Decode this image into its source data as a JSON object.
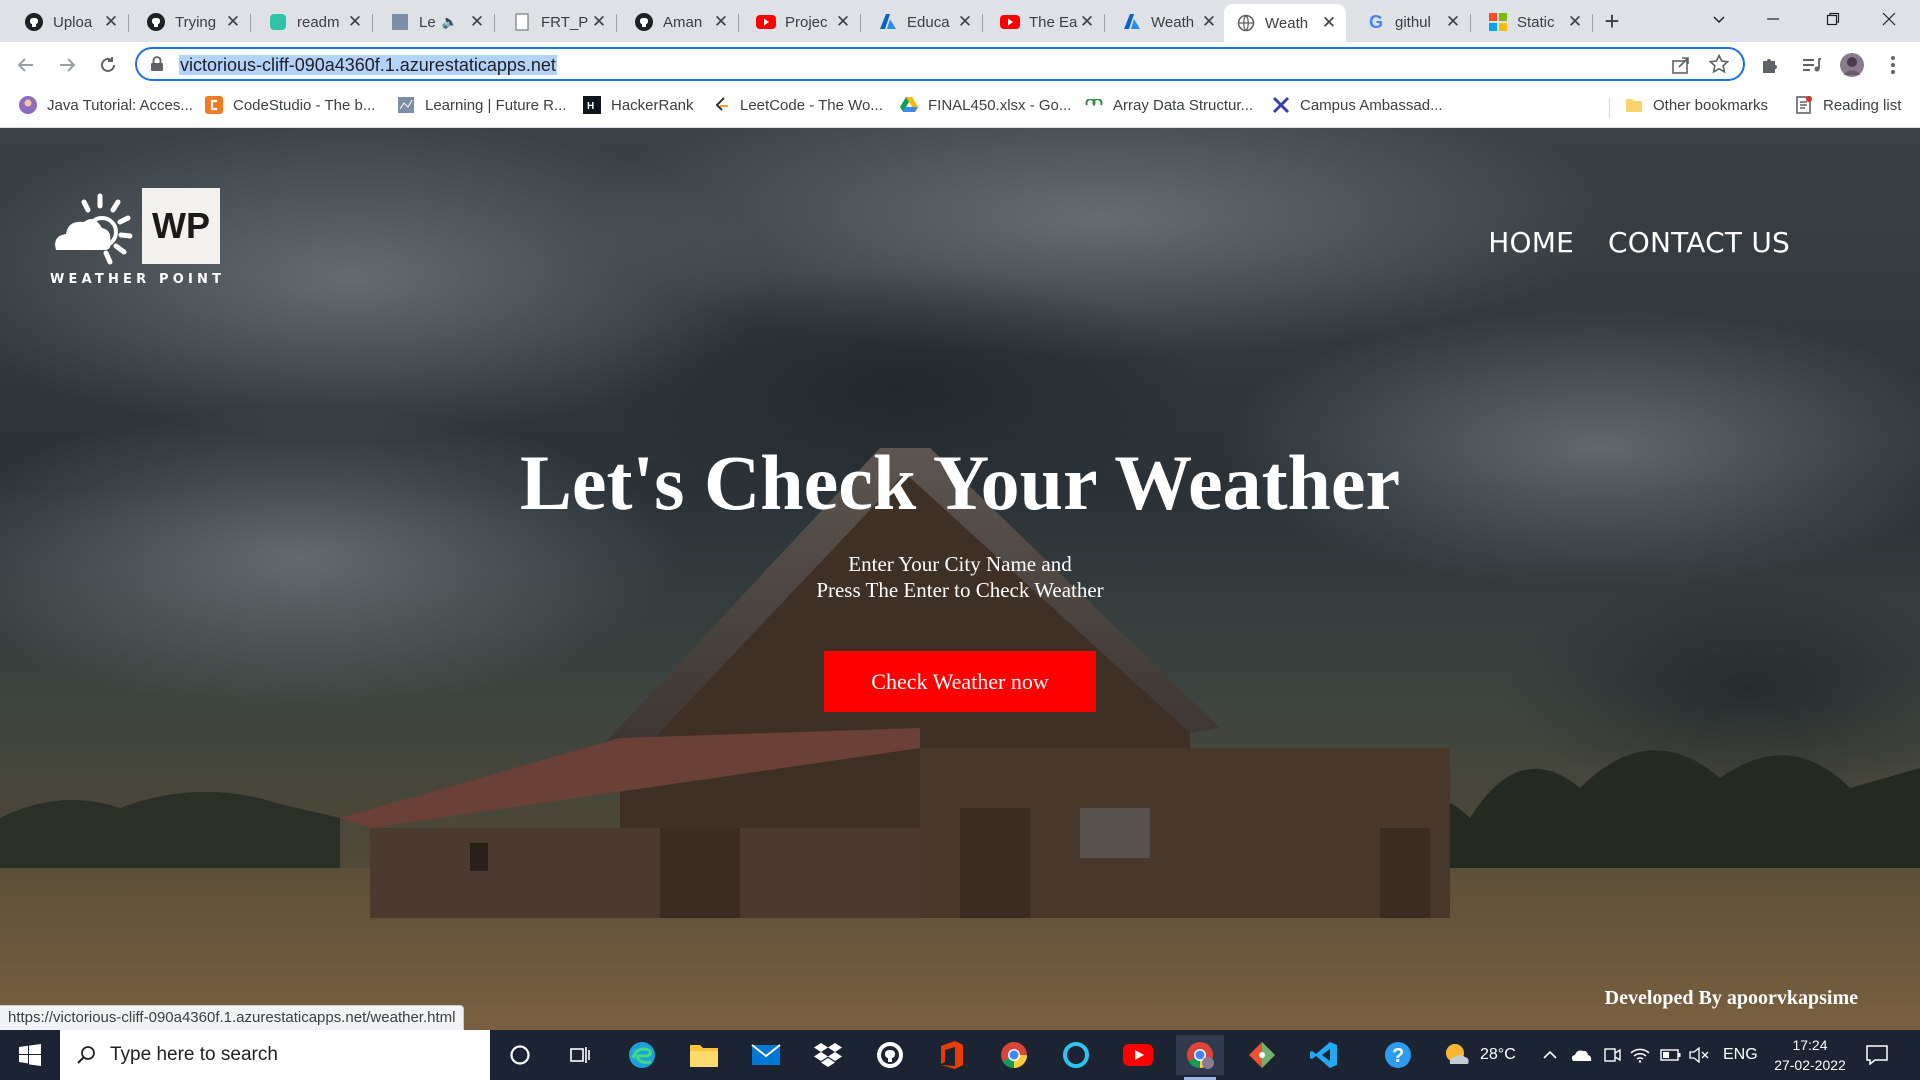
{
  "browser": {
    "tabs": [
      {
        "title": "Uploa",
        "icon": "github-icon",
        "active": false
      },
      {
        "title": "Trying",
        "icon": "github-icon",
        "active": false
      },
      {
        "title": "readm",
        "icon": "readme-icon",
        "active": false
      },
      {
        "title": "Le",
        "icon": "learning-icon",
        "active": false
      },
      {
        "title": "FRT_P",
        "icon": "document-icon",
        "active": false
      },
      {
        "title": "Aman",
        "icon": "github-icon",
        "active": false
      },
      {
        "title": "Projec",
        "icon": "youtube-icon",
        "active": false
      },
      {
        "title": "Educa",
        "icon": "azure-icon",
        "active": false
      },
      {
        "title": "The Ea",
        "icon": "youtube-icon",
        "active": false
      },
      {
        "title": "Weath",
        "icon": "azure-icon",
        "active": false
      },
      {
        "title": "Weath",
        "icon": "globe-icon",
        "active": true
      },
      {
        "title": "githul",
        "icon": "google-icon",
        "active": false
      },
      {
        "title": "Static",
        "icon": "microsoft-icon",
        "active": false
      }
    ],
    "url": "victorious-cliff-090a4360f.1.azurestaticapps.net",
    "bookmarks": [
      {
        "label": "Java Tutorial: Acces...",
        "icon": "avatar-icon"
      },
      {
        "label": "CodeStudio - The b...",
        "icon": "codestudio-icon"
      },
      {
        "label": "Learning | Future R...",
        "icon": "learning-icon"
      },
      {
        "label": "HackerRank",
        "icon": "hackerrank-icon"
      },
      {
        "label": "LeetCode - The Wo...",
        "icon": "leetcode-icon"
      },
      {
        "label": "FINAL450.xlsx - Go...",
        "icon": "google-drive-icon"
      },
      {
        "label": "Array Data Structur...",
        "icon": "gfg-icon"
      },
      {
        "label": "Campus Ambassad...",
        "icon": "x-logo-icon"
      }
    ],
    "other_bookmarks": "Other bookmarks",
    "reading_list": "Reading list",
    "status_url": "https://victorious-cliff-090a4360f.1.azurestaticapps.net/weather.html"
  },
  "site": {
    "logo_mark": "WP",
    "logo_text": "WEATHER POINT",
    "nav": [
      "HOME",
      "CONTACT US"
    ],
    "hero_title": "Let's Check Your Weather",
    "hero_sub_line1": "Enter Your City Name and",
    "hero_sub_line2": "Press The Enter to Check Weather",
    "cta_label": "Check Weather now",
    "footer": "Developed By apoorvkapsime",
    "cta_color": "#ff0000"
  },
  "taskbar": {
    "search_placeholder": "Type here to search",
    "temperature": "28°C",
    "language": "ENG",
    "time": "17:24",
    "date": "27-02-2022"
  }
}
